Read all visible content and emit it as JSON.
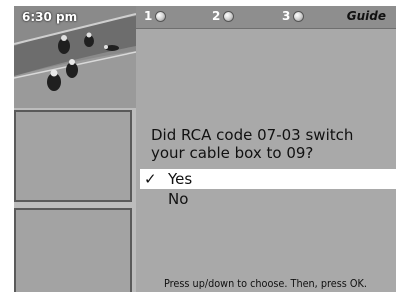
{
  "screen": {
    "time": "6:30 pm",
    "steps": [
      "1",
      "2",
      "3"
    ],
    "brand": "Guide",
    "question": "Did RCA code 07-03 switch your cable box to 09?",
    "options": [
      {
        "label": "Yes",
        "selected": true,
        "check": "✓"
      },
      {
        "label": "No",
        "selected": false,
        "check": ""
      }
    ],
    "hint": "Press up/down to choose. Then, press OK."
  }
}
